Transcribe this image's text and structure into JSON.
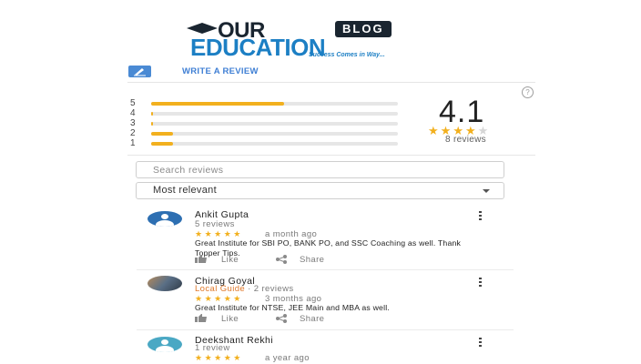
{
  "logo": {
    "our": "OUR",
    "blog": "BLOG",
    "education": "EDUCATION",
    "tagline": "Success Comes in Way..."
  },
  "write_review": {
    "label": "WRITE A REVIEW"
  },
  "help": {
    "icon": "help-circle-icon",
    "glyph": "?"
  },
  "summary": {
    "rating": "4.1",
    "stars_filled": 4,
    "stars_total": 5,
    "count_text": "8 reviews",
    "histogram": [
      {
        "label": "5",
        "fill": 0.54
      },
      {
        "label": "4",
        "fill": 0.005
      },
      {
        "label": "3",
        "fill": 0.005
      },
      {
        "label": "2",
        "fill": 0.09
      },
      {
        "label": "1",
        "fill": 0.09
      }
    ],
    "accent_color": "#f2b01e"
  },
  "search": {
    "placeholder": "Search reviews",
    "value": ""
  },
  "sort": {
    "selected": "Most relevant"
  },
  "reviews": [
    {
      "name": "Ankit Gupta",
      "sub": "5 reviews",
      "local_guide": "",
      "stars": "★★★★★",
      "when": "a month ago",
      "text": "Great Institute for SBI PO, BANK PO, and SSC Coaching as well. Thank Topper Tips.",
      "like": "Like",
      "share": "Share",
      "avatar": "default-blue"
    },
    {
      "name": "Chirag Goyal",
      "sub": "· 2 reviews",
      "local_guide": "Local Guide",
      "stars": "★★★★★",
      "when": "3 months ago",
      "text": "Great Institute for NTSE, JEE Main and MBA as well.",
      "like": "Like",
      "share": "Share",
      "avatar": "photo"
    },
    {
      "name": "Deekshant Rekhi",
      "sub": "1 review",
      "local_guide": "",
      "stars": "★★★★★",
      "when": "a year ago",
      "avatar": "default-teal"
    }
  ]
}
